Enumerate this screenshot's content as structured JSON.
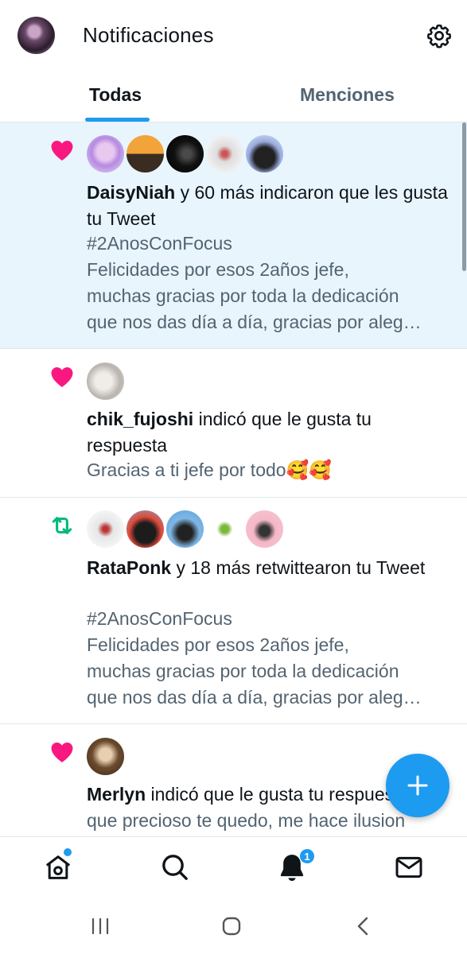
{
  "header": {
    "title": "Notificaciones",
    "avatar_icon": "profile-avatar",
    "settings_icon": "gear-icon"
  },
  "tabs": [
    {
      "label": "Todas",
      "active": true
    },
    {
      "label": "Menciones",
      "active": false
    }
  ],
  "notifications": [
    {
      "type": "like",
      "icon": "heart-icon",
      "unread": true,
      "user": "DaisyNiah",
      "action": " y 60 más indicaron que les gusta tu Tweet",
      "hashtag": "#2AnosConFocus",
      "preview": [
        "Felicidades por esos 2años jefe,",
        "muchas gracias por toda la dedicación",
        "que nos das día a día,  gracias por aleg…"
      ]
    },
    {
      "type": "like",
      "icon": "heart-icon",
      "unread": false,
      "user": "chik_fujoshi",
      "action": " indicó que le gusta tu respuesta",
      "preview": [
        "Gracias a ti jefe por todo🥰🥰"
      ]
    },
    {
      "type": "retweet",
      "icon": "retweet-icon",
      "unread": false,
      "user": "RataPonk",
      "action": " y 18 más retwittearon tu Tweet",
      "hashtag": "#2AnosConFocus",
      "preview": [
        "Felicidades por esos 2años jefe,",
        "muchas gracias por toda la dedicación",
        "que nos das día a día,  gracias por aleg…"
      ]
    },
    {
      "type": "like",
      "icon": "heart-icon",
      "unread": false,
      "user": "Merlyn",
      "action": " indicó que le gusta tu respuesta",
      "preview": [
        "que precioso te quedo, me hace ilusion"
      ]
    }
  ],
  "bottom_nav": [
    {
      "name": "home",
      "icon": "home-icon",
      "has_dot": true
    },
    {
      "name": "search",
      "icon": "search-icon"
    },
    {
      "name": "notifications",
      "icon": "bell-icon",
      "badge": "1"
    },
    {
      "name": "messages",
      "icon": "mail-icon"
    }
  ],
  "compose": {
    "icon": "plus-icon"
  },
  "colors": {
    "accent": "#1d9bf0",
    "like": "#f91880",
    "retweet": "#00ba7c",
    "unread_bg": "#e8f5fd"
  }
}
